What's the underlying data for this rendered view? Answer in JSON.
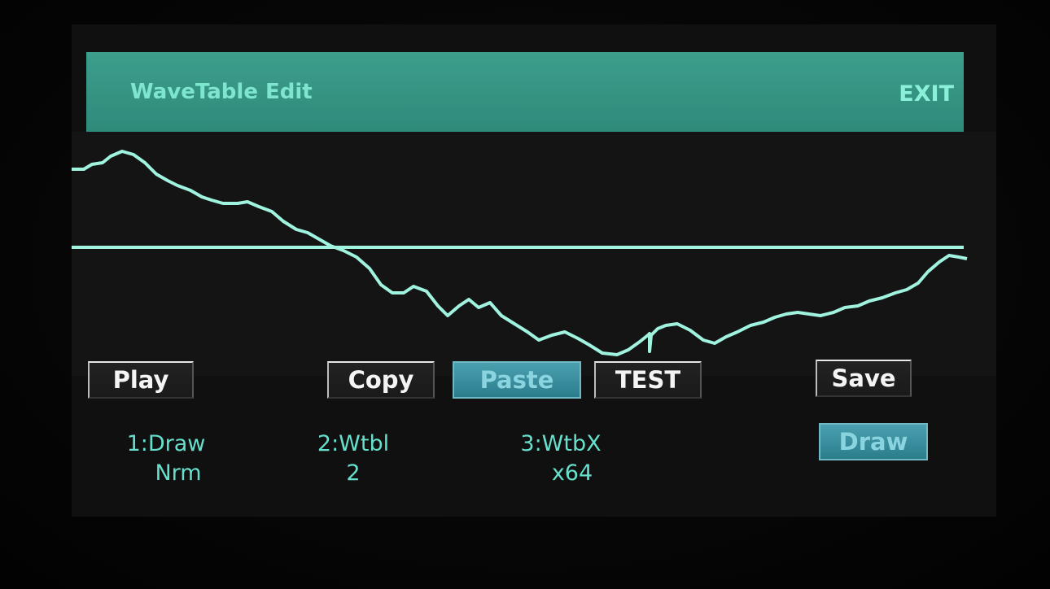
{
  "header": {
    "title": "WaveTable Edit",
    "exit_label": "EXIT"
  },
  "buttons": {
    "play": "Play",
    "copy": "Copy",
    "paste": "Paste",
    "test": "TEST",
    "save": "Save",
    "draw": "Draw"
  },
  "params": [
    {
      "label": "1:Draw",
      "value": "Nrm"
    },
    {
      "label": "2:Wtbl",
      "value": "2"
    },
    {
      "label": "3:WtbX",
      "value": "x64"
    }
  ],
  "colors": {
    "accent": "#3d9e8c",
    "waveform": "#9ff3df",
    "text": "#66e0cc"
  }
}
